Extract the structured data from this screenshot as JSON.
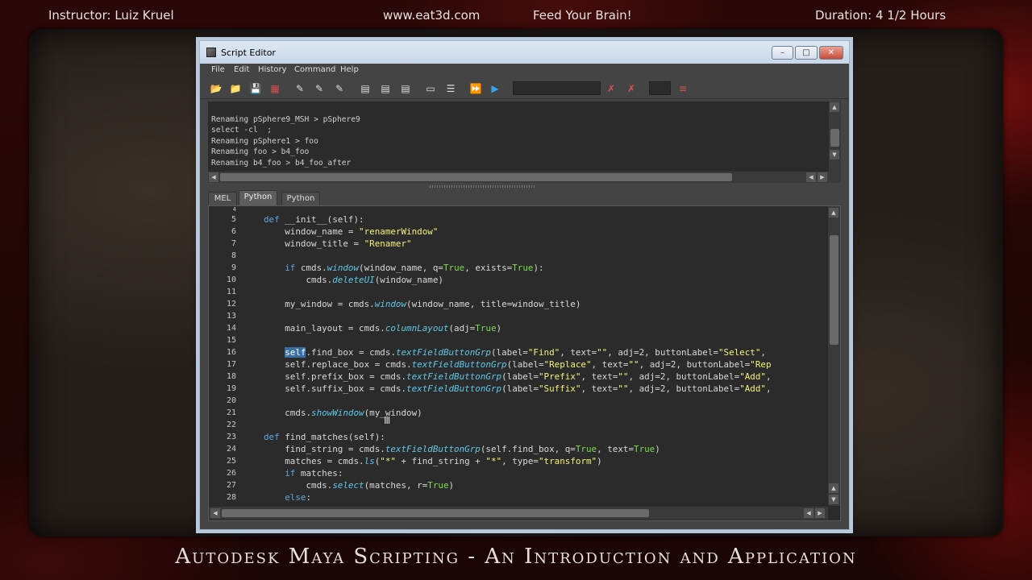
{
  "header": {
    "instructor": "Instructor: Luiz Kruel",
    "website": "www.eat3d.com",
    "tagline": "Feed Your Brain!",
    "duration": "Duration: 4 1/2 Hours"
  },
  "footer": {
    "title": "Autodesk Maya Scripting - An Introduction and Application"
  },
  "window": {
    "title": "Script Editor",
    "minimize": "–",
    "maximize": "□",
    "close": "✕"
  },
  "menu": [
    "File",
    "Edit",
    "History",
    "Command",
    "Help"
  ],
  "toolbar": {
    "icons": [
      "open-script-icon",
      "source-script-icon",
      "save-script-icon",
      "save-to-shelf-icon",
      "clear-history-icon",
      "clear-input-icon",
      "clear-all-icon",
      "show-history-icon",
      "show-input-icon",
      "show-both-icon",
      "echo-all-icon",
      "line-numbers-icon",
      "execute-all-icon",
      "execute-icon",
      "search-clear-icon",
      "search-icon",
      "tab-icon",
      "indent-icon"
    ]
  },
  "output": {
    "lines": [
      "Renaming pSphere9_MSH > pSphere9",
      "select -cl  ;",
      "Renaming pSphere1 > foo",
      "Renaming foo > b4_foo",
      "Renaming b4_foo > b4_foo_after"
    ]
  },
  "tabs": [
    {
      "label": "MEL",
      "active": false
    },
    {
      "label": "Python",
      "active": true
    },
    {
      "label": "Python",
      "active": false
    }
  ],
  "editor": {
    "line_numbers": [
      "5",
      "6",
      "7",
      "8",
      "9",
      "10",
      "11",
      "12",
      "13",
      "14",
      "15",
      "16",
      "17",
      "18",
      "19",
      "20",
      "21",
      "22",
      "23",
      "24",
      "25",
      "26",
      "27",
      "28"
    ],
    "colors": {
      "keyword": "#5da5e0",
      "string": "#f2f27a",
      "boolean": "#7ddc50",
      "function": "#5fc9e8"
    }
  }
}
